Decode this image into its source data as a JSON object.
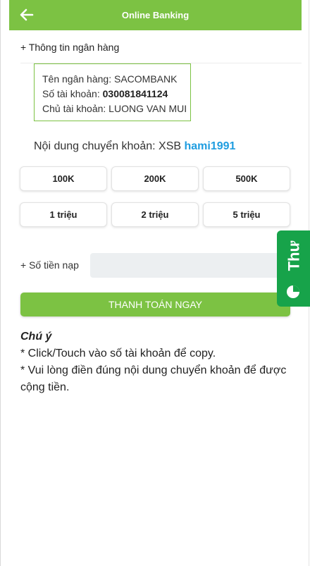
{
  "header": {
    "title": "Online Banking"
  },
  "bank_info": {
    "section_title": "+ Thông tin ngân hàng",
    "bank_name_label": "Tên ngân hàng: ",
    "bank_name": "SACOMBANK",
    "account_number_label": "Số tài khoản: ",
    "account_number": "030081841124",
    "account_holder_label": "Chủ tài khoản: ",
    "account_holder": "LUONG VAN MUI"
  },
  "transfer": {
    "label": "Nội dung chuyển khoản: XSB ",
    "code": "hami1991"
  },
  "amounts": [
    "100K",
    "200K",
    "500K",
    "1 triệu",
    "2 triệu",
    "5 triệu"
  ],
  "form": {
    "amount_label": "+ Số tiền nạp",
    "amount_value": "",
    "submit_label": "THANH TOÁN NGAY"
  },
  "side_tab": {
    "label": "Thư"
  },
  "notes": {
    "title": "Chú ý",
    "line1": "* Click/Touch vào số tài khoản để copy.",
    "line2": "* Vui lòng điền đúng nội dung chuyển khoản để được cộng tiền."
  },
  "colors": {
    "brand_green": "#7cc243",
    "link_blue": "#1f9de0",
    "tab_green": "#17a34a"
  }
}
